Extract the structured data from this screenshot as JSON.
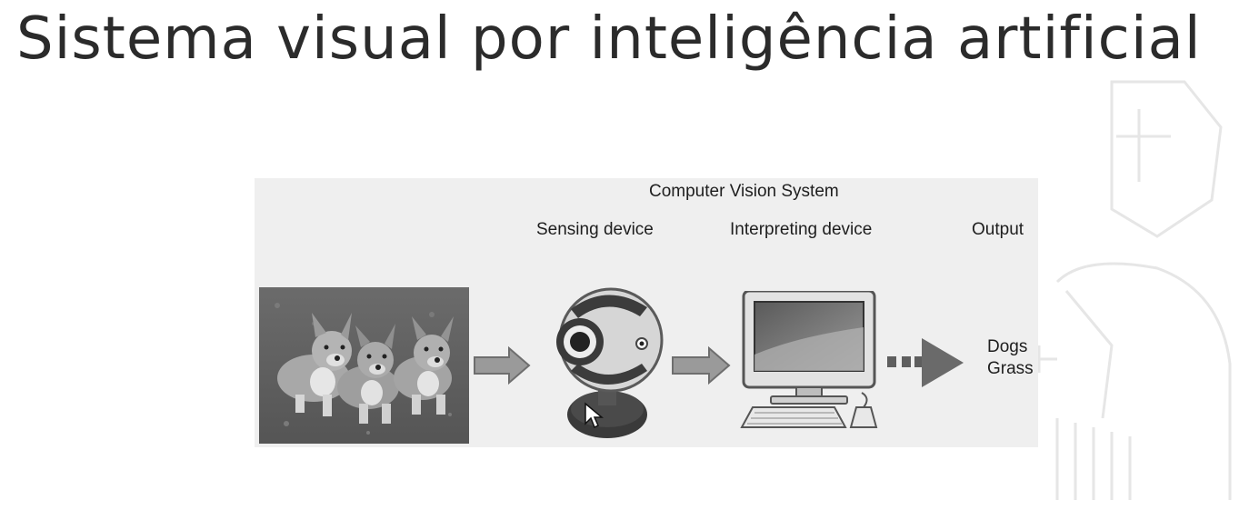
{
  "slide": {
    "title": "Sistema visual por inteligência artificial"
  },
  "diagram": {
    "title": "Computer Vision System",
    "stages": [
      "Sensing device",
      "Interpreting device",
      "Output"
    ],
    "output_items": [
      "Dogs",
      "Grass"
    ]
  },
  "colors": {
    "title_text": "#2b2b2b",
    "figure_bg": "#efefef",
    "arrow_fill": "#9a9a9a",
    "arrow_stroke": "#6e6e6e",
    "output_triangle": "#6a6a6a"
  },
  "icons": [
    "dogs-photo",
    "webcam-icon",
    "computer-icon",
    "arrow-right-icon",
    "mouse-cursor-icon",
    "watermark-logo"
  ]
}
